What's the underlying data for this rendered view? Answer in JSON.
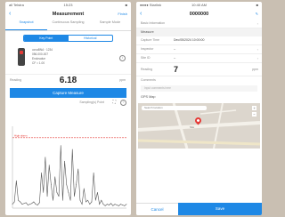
{
  "left": {
    "status": {
      "carrier": "all Telstra",
      "time": "15:23",
      "battery": "■"
    },
    "nav": {
      "back": "‹",
      "title": "Measurement",
      "action": "Finish"
    },
    "tabs": [
      {
        "label": "Snapshot"
      },
      {
        "label": "Continuous Sampling"
      },
      {
        "label": "Sample Mode"
      }
    ],
    "modes": [
      {
        "label": "Key Point"
      },
      {
        "label": "Historical"
      }
    ],
    "device": {
      "line1": "ucvaBNA · 1234",
      "line2": "056-000-007",
      "line3": "Endovalue",
      "line4": "CF = 1.00"
    },
    "reading": {
      "label": "Reading",
      "value": "6.18",
      "unit": "ppm"
    },
    "capture_label": "Capture Measure",
    "sampling": {
      "label": "Sampling(s) Point",
      "expand_icon": "⛶",
      "help_icon": "?"
    },
    "chart_legend": "High alarm"
  },
  "right": {
    "status": {
      "carrier": "●●●● Starlink",
      "time": "10:40 AM",
      "battery": "■"
    },
    "nav": {
      "back": "‹",
      "title": "0000000",
      "edit_icon": "✎"
    },
    "basic_info": "Basic Information",
    "measure_section": "Measure",
    "fields": [
      {
        "key": "Capture Time",
        "value": "Dec/05/2024 10:00:00"
      },
      {
        "key": "Inspector",
        "value": "--"
      },
      {
        "key": "Site ID",
        "value": "--"
      }
    ],
    "reading": {
      "key": "Reading",
      "value": "7",
      "unit": "ppm"
    },
    "comments": {
      "key": "Comments",
      "placeholder": "Input comments here"
    },
    "gps_label": "GPS Map",
    "map": {
      "search": "Search location",
      "place": "Site",
      "zoom_in": "+",
      "zoom_out": "−"
    },
    "cancel_label": "Cancel",
    "save_label": "Save"
  },
  "chart_data": {
    "type": "line",
    "x": [
      0,
      1,
      2,
      3,
      4,
      5,
      6,
      7,
      8,
      9,
      10,
      11,
      12,
      13,
      14,
      15,
      16,
      17,
      18,
      19,
      20,
      21,
      22,
      23,
      24,
      25,
      26,
      27,
      28,
      29,
      30,
      31,
      32,
      33,
      34,
      35,
      36,
      37,
      38,
      39,
      40,
      41,
      42,
      43,
      44,
      45,
      46,
      47,
      48,
      49,
      50,
      51,
      52,
      53,
      54,
      55,
      56,
      57,
      58,
      59
    ],
    "values": [
      0.5,
      0.8,
      3.5,
      1,
      0.8,
      0.5,
      0.6,
      0.7,
      0.4,
      0.5,
      0.6,
      0.8,
      0.5,
      0.4,
      0.7,
      4.5,
      2,
      6.5,
      1.5,
      5.5,
      3,
      1,
      4,
      2,
      1.5,
      8,
      1,
      6,
      3,
      2,
      1,
      7.5,
      1.5,
      3,
      5,
      1,
      0.5,
      2.5,
      0.8,
      1,
      0.5,
      0.8,
      4.5,
      1,
      2,
      0.5,
      1,
      0.5,
      0.3,
      0.5,
      0.4,
      0.6,
      0.3,
      0.5,
      0.4,
      0.3,
      0.5,
      0.4,
      0.3,
      0.5
    ],
    "ylim": [
      0,
      10
    ],
    "threshold": 9,
    "threshold_label": "High alarm",
    "grid": false
  }
}
